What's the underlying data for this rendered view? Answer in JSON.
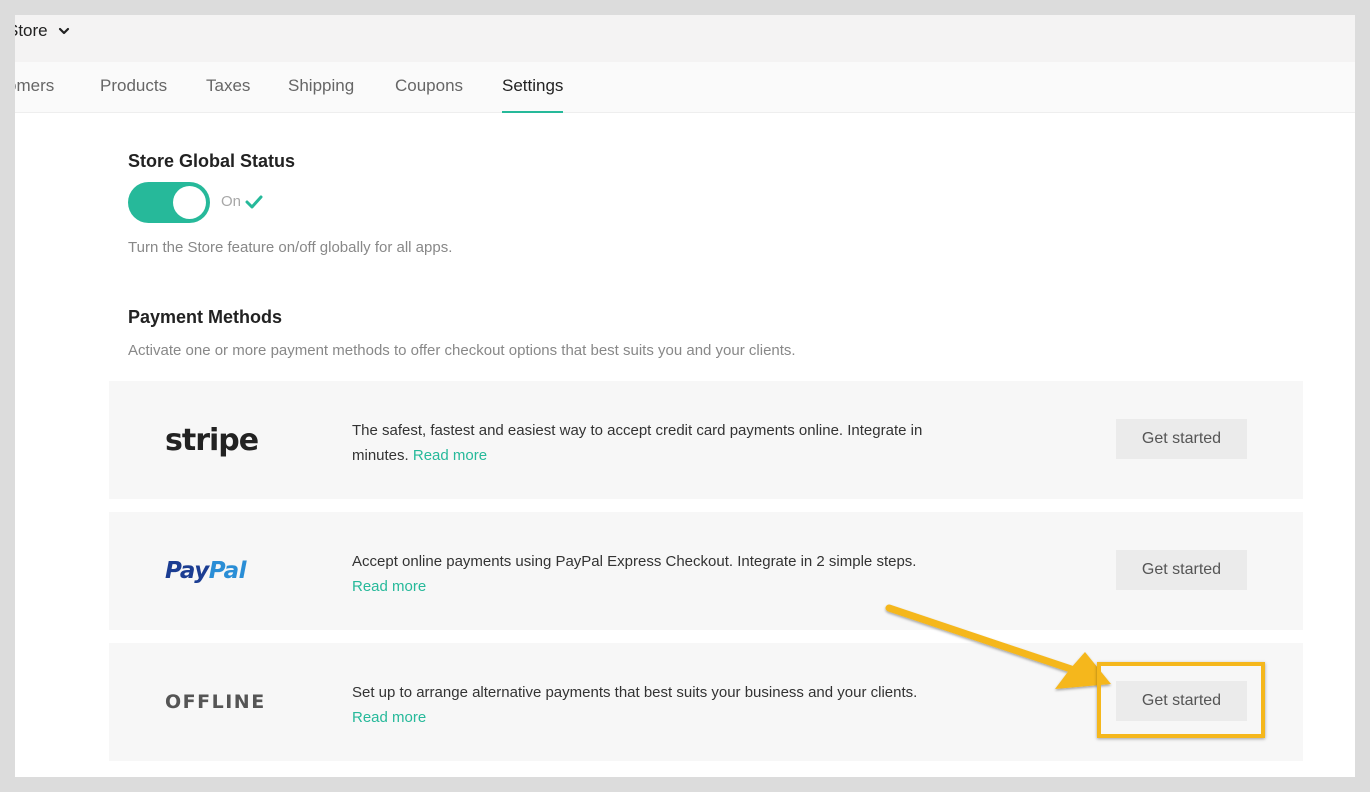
{
  "header": {
    "store_name": "Store"
  },
  "tabs": [
    {
      "label": "omers",
      "active": false
    },
    {
      "label": "Products",
      "active": false
    },
    {
      "label": "Taxes",
      "active": false
    },
    {
      "label": "Shipping",
      "active": false
    },
    {
      "label": "Coupons",
      "active": false
    },
    {
      "label": "Settings",
      "active": true
    }
  ],
  "global_status": {
    "title": "Store Global Status",
    "toggle_on": true,
    "state_label": "On",
    "description": "Turn the Store feature on/off globally for all apps."
  },
  "payment_methods": {
    "title": "Payment Methods",
    "description": "Activate one or more payment methods to offer checkout options that best suits you and your clients.",
    "items": [
      {
        "logo": "stripe",
        "description": "The safest, fastest and easiest way to accept credit card payments online. Integrate in minutes.",
        "read_more": "Read more",
        "button": "Get started"
      },
      {
        "logo_pay": "Pay",
        "logo_pal": "Pal",
        "description": "Accept online payments using PayPal Express Checkout. Integrate in 2 simple steps.",
        "read_more": "Read more",
        "button": "Get started"
      },
      {
        "logo": "OFFLINE",
        "description": "Set up to arrange alternative payments that best suits your business and your clients.",
        "read_more": "Read more",
        "button": "Get started"
      }
    ]
  },
  "colors": {
    "accent": "#26b99a",
    "highlight": "#f5b71c",
    "paypal_dark": "#1b3d92",
    "paypal_light": "#2a8ed6"
  },
  "icons": [
    "chevron-down-icon",
    "checkmark-icon",
    "arrow-annotation"
  ]
}
